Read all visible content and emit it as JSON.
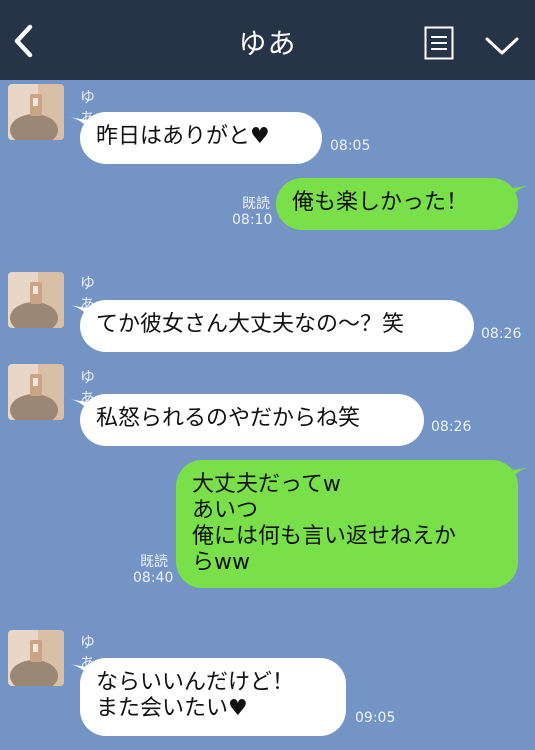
{
  "header": {
    "title": "ゆあ",
    "back_icon": "chevron-left-icon",
    "menu_icon": "memo-list-icon",
    "expand_icon": "chevron-down-icon"
  },
  "colors": {
    "background": "#7394c5",
    "header": "#273448",
    "incoming_bubble": "#ffffff",
    "outgoing_bubble": "#79e04a"
  },
  "messages": [
    {
      "side": "left",
      "sender": "ゆあ",
      "text": "昨日はありがと♥",
      "time": "08:05"
    },
    {
      "side": "right",
      "read": "既読",
      "text": "俺も楽しかった！",
      "time": "08:10"
    },
    {
      "side": "left",
      "sender": "ゆあ",
      "text": "てか彼女さん大丈夫なの〜？笑",
      "time": "08:26"
    },
    {
      "side": "left",
      "sender": "ゆあ",
      "text": "私怒られるのやだからね笑",
      "time": "08:26"
    },
    {
      "side": "right",
      "read": "既読",
      "text": "大丈夫だってw\nあいつ\n俺には何も言い返せねえか\nらww",
      "time": "08:40"
    },
    {
      "side": "left",
      "sender": "ゆあ",
      "text": "ならいいんだけど！\nまた会いたい♥",
      "time": "09:05"
    }
  ]
}
